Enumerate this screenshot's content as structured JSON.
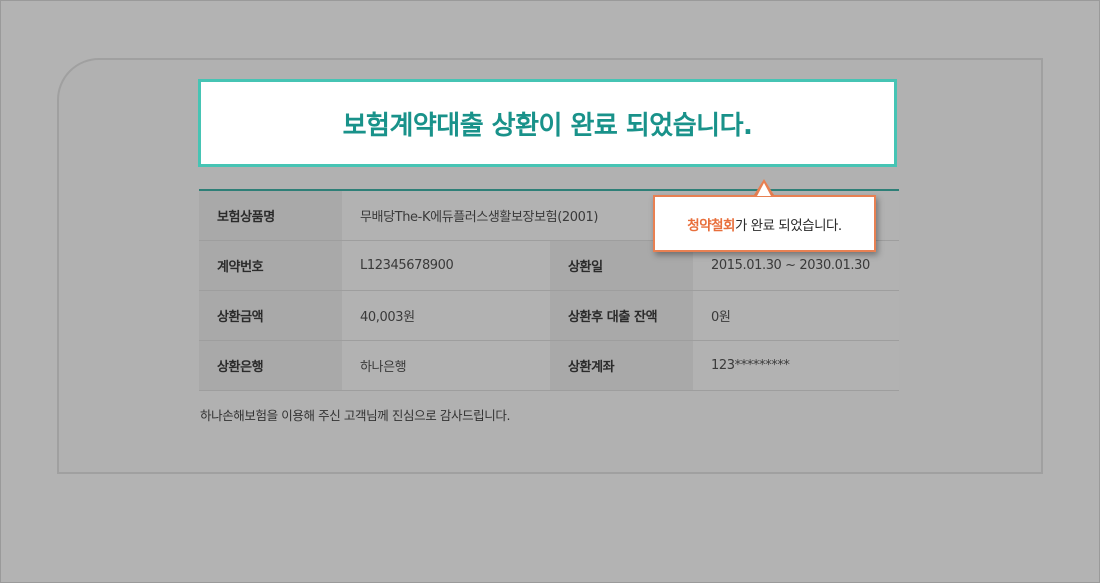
{
  "banner": {
    "message": "보험계약대출 상환이 완료 되었습니다."
  },
  "table": {
    "rows": [
      {
        "label1": "보험상품명",
        "value1": "무배당The-K에듀플러스생활보장보험(2001)"
      },
      {
        "label1": "계약번호",
        "value1": "L12345678900",
        "label2": "상환일",
        "value2": "2015.01.30 ~ 2030.01.30"
      },
      {
        "label1": "상환금액",
        "value1": "40,003원",
        "label2": "상환후 대출 잔액",
        "value2": "0원"
      },
      {
        "label1": "상환은행",
        "value1": "하나은행",
        "label2": "상환계좌",
        "value2": "123*********"
      }
    ]
  },
  "footer": {
    "thanks": "하나손해보험을 이용해 주신 고객님께 진심으로 감사드립니다."
  },
  "tooltip": {
    "highlight": "청약철회",
    "rest": "가 완료 되었습니다."
  },
  "colors": {
    "accent": "#19928a",
    "banner_border": "#46c4b4",
    "tooltip_border": "#e88052",
    "highlight": "#e86f3c"
  }
}
